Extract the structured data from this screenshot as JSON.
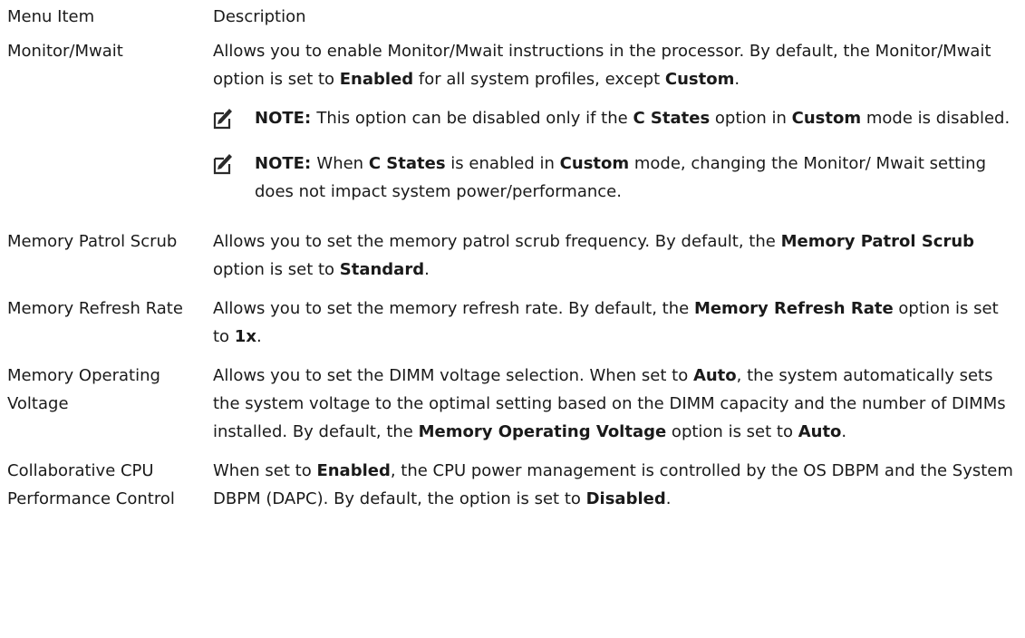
{
  "table": {
    "headers": {
      "item": "Menu Item",
      "description": "Description"
    },
    "rows": [
      {
        "item": "Monitor/Mwait",
        "desc": [
          {
            "t": "Allows you to enable Monitor/Mwait instructions in the processor. By default, the Monitor/Mwait option is set to "
          },
          {
            "b": "Enabled"
          },
          {
            "t": " for all system profiles, except "
          },
          {
            "b": "Custom"
          },
          {
            "t": "."
          }
        ],
        "notes": [
          [
            {
              "b": "NOTE: "
            },
            {
              "t": "This option can be disabled only if the "
            },
            {
              "b": "C States"
            },
            {
              "t": " option in "
            },
            {
              "b": "Custom"
            },
            {
              "t": " mode is disabled."
            }
          ],
          [
            {
              "b": "NOTE: "
            },
            {
              "t": "When "
            },
            {
              "b": "C States"
            },
            {
              "t": " is enabled in "
            },
            {
              "b": "Custom"
            },
            {
              "t": " mode, changing the Monitor/ Mwait setting does not impact system power/performance."
            }
          ]
        ]
      },
      {
        "item": "Memory Patrol Scrub",
        "desc": [
          {
            "t": "Allows you to set the memory patrol scrub frequency. By default, the "
          },
          {
            "b": "Memory Patrol Scrub"
          },
          {
            "t": " option is set to "
          },
          {
            "b": "Standard"
          },
          {
            "t": "."
          }
        ]
      },
      {
        "item": "Memory Refresh Rate",
        "desc": [
          {
            "t": "Allows you to set the memory refresh rate. By default, the "
          },
          {
            "b": "Memory Refresh Rate"
          },
          {
            "t": " option is set to "
          },
          {
            "b": "1x"
          },
          {
            "t": "."
          }
        ]
      },
      {
        "item": "Memory Operating Voltage",
        "desc": [
          {
            "t": "Allows you to set the DIMM voltage selection. When set to "
          },
          {
            "b": "Auto"
          },
          {
            "t": ", the system automatically sets the system voltage to the optimal setting based on the DIMM capacity and the number of DIMMs installed. By default, the "
          },
          {
            "b": "Memory Operating Voltage"
          },
          {
            "t": " option is set to "
          },
          {
            "b": "Auto"
          },
          {
            "t": "."
          }
        ]
      },
      {
        "item": "Collaborative CPU Performance Control",
        "desc": [
          {
            "t": "When set to "
          },
          {
            "b": "Enabled"
          },
          {
            "t": ", the CPU power management is controlled by the OS DBPM and the System DBPM (DAPC). By default, the option is set to "
          },
          {
            "b": "Disabled"
          },
          {
            "t": "."
          }
        ]
      }
    ]
  },
  "icons": {
    "note": "pencil-note-icon"
  }
}
